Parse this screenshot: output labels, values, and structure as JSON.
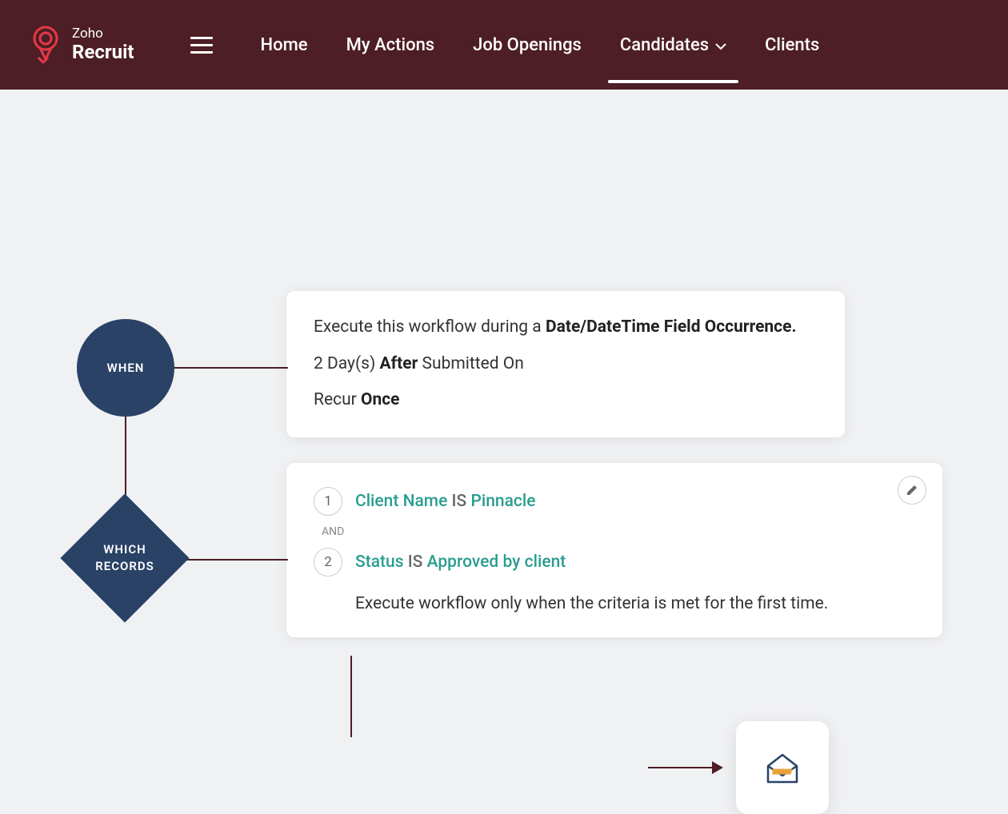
{
  "header": {
    "logo": {
      "line1": "Zoho",
      "line2": "Recruit"
    },
    "nav": [
      {
        "label": "Home",
        "active": false
      },
      {
        "label": "My Actions",
        "active": false
      },
      {
        "label": "Job Openings",
        "active": false
      },
      {
        "label": "Candidates",
        "active": true,
        "hasDropdown": true
      },
      {
        "label": "Clients",
        "active": false
      }
    ]
  },
  "workflow": {
    "nodes": {
      "when": "WHEN",
      "which_line1": "WHICH",
      "which_line2": "RECORDS"
    },
    "when_card": {
      "line1_prefix": "Execute this workflow during a ",
      "line1_bold": "Date/DateTime Field Occurrence.",
      "line2_prefix": "2 Day(s) ",
      "line2_bold": "After",
      "line2_suffix": " Submitted On",
      "line3_prefix": "Recur ",
      "line3_bold": "Once"
    },
    "which_card": {
      "criteria": [
        {
          "num": "1",
          "field": "Client Name",
          "op": "IS",
          "value": "Pinnacle"
        },
        {
          "num": "2",
          "field": "Status",
          "op": "IS",
          "value": "Approved by client"
        }
      ],
      "join": "AND",
      "note": "Execute workflow only when the criteria is met for the first time."
    }
  }
}
